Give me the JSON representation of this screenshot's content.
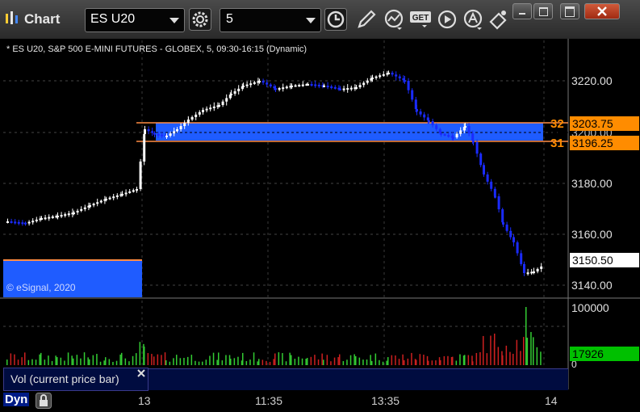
{
  "window": {
    "title": "Chart",
    "symbol": "ES U20",
    "interval": "5"
  },
  "chart_info": "* ES U20, S&P 500 E-MINI FUTURES - GLOBEX, 5, 09:30-16:15 (Dynamic)",
  "copyright": "© eSignal, 2020",
  "study_label": "Vol (current price bar)",
  "dyn_label": "Dyn",
  "price_axis": {
    "ticks": [
      "3220.00",
      "3200.00",
      "3180.00",
      "3160.00",
      "3140.00"
    ]
  },
  "volume_axis": {
    "ticks": [
      "100000",
      "0"
    ],
    "current_volume": "17926"
  },
  "time_axis": {
    "labels": [
      "13",
      "11:35",
      "13:35",
      "14"
    ]
  },
  "levels": [
    {
      "label": "32",
      "price": "3203.75"
    },
    {
      "label": "31",
      "price": "3196.25"
    }
  ],
  "current_price": "3150.50",
  "colors": {
    "zone_fill": "#1f5cff",
    "level_line": "#ff8c42",
    "up_candle": "#ffffff",
    "down_candle": "#1a2bff",
    "volume_up": "#33cc33",
    "volume_down": "#cc2020",
    "level_tag": "#ff8c00",
    "volume_tag": "#00c000"
  },
  "icons": [
    "chart-app-icon",
    "symbol-dropdown-icon",
    "settings-gear-icon",
    "interval-dropdown-icon",
    "clock-icon",
    "pencil-icon",
    "indicator-icon",
    "get-data-icon",
    "play-icon",
    "text-annotation-icon",
    "link-icon",
    "minimize-icon",
    "restore-icon",
    "maximize-icon",
    "close-icon",
    "lock-icon",
    "close-study-icon"
  ]
}
